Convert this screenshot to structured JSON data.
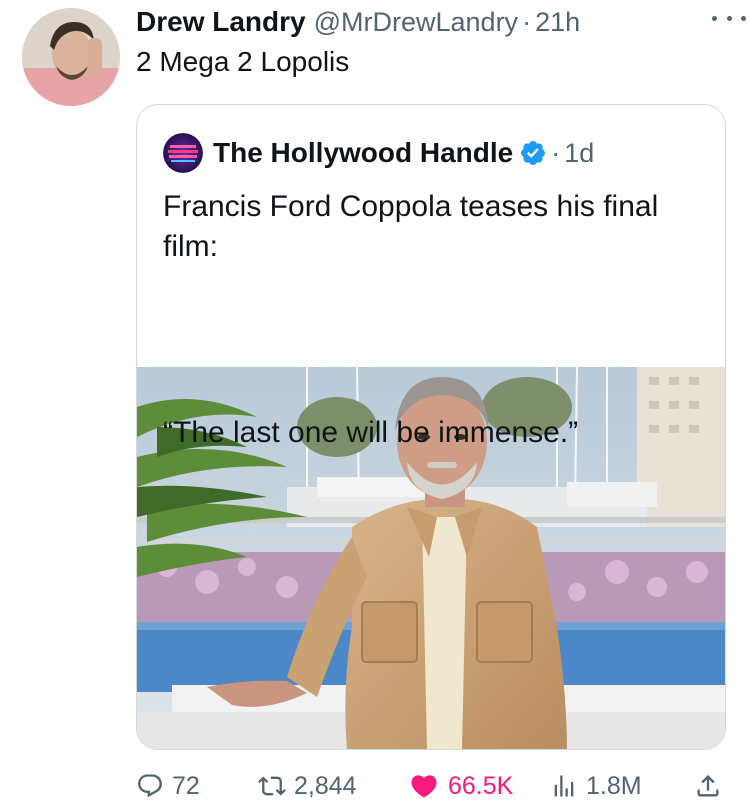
{
  "tweet": {
    "author_name": "Drew Landry",
    "author_handle": "@MrDrewLandry",
    "separator": "·",
    "time": "21h",
    "text": "2 Mega 2 Lopolis",
    "more_icon": "more-horizontal-icon"
  },
  "quoted": {
    "author_name": "The Hollywood Handle",
    "verified_icon": "verified-badge-icon",
    "verified_color": "#1d9bf0",
    "separator": "·",
    "time": "1d",
    "text": "Francis Ford Coppola teases his final film:",
    "quote": "“The last one will be immense.”",
    "image_subject": "photo"
  },
  "actions": {
    "replies": "72",
    "reposts": "2,844",
    "likes": "66.5K",
    "views": "1.8M",
    "liked": true,
    "like_color": "#f91880",
    "muted_color": "#536471"
  }
}
